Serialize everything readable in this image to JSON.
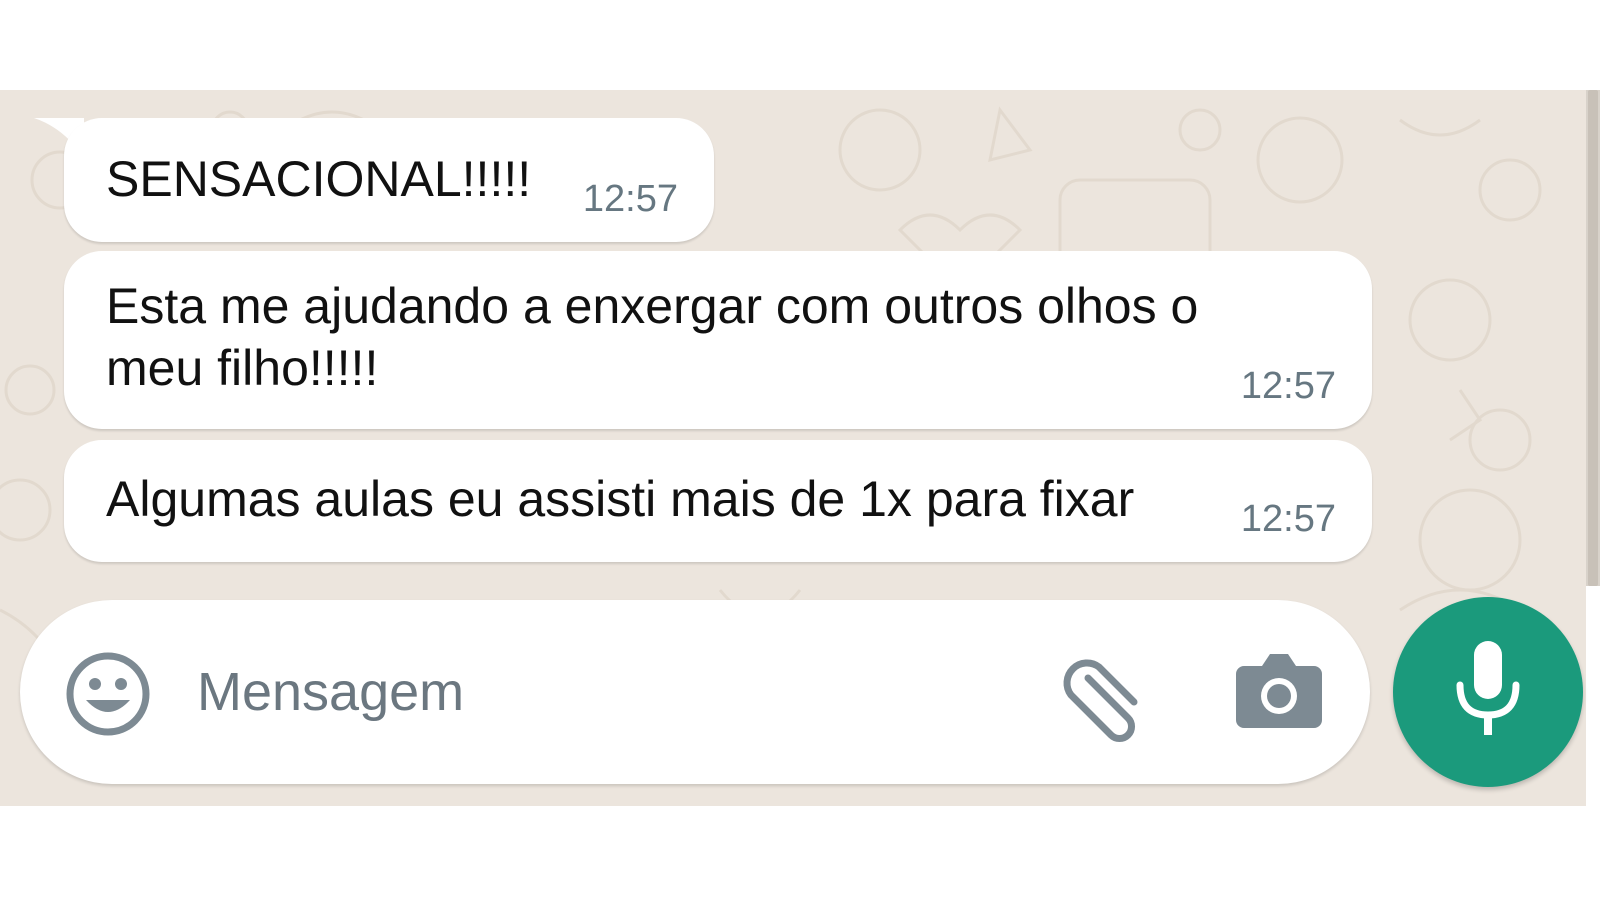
{
  "messages": [
    {
      "text": "SENSACIONAL!!!!!",
      "time": "12:57"
    },
    {
      "text": "Esta me ajudando a enxergar com outros olhos o\nmeu filho!!!!!",
      "time": "12:57"
    },
    {
      "text": "Algumas aulas eu assisti mais de 1x para fixar",
      "time": "12:57"
    }
  ],
  "composer": {
    "placeholder": "Mensagem",
    "emoji_icon": "smiley-icon",
    "attach_icon": "paperclip-icon",
    "camera_icon": "camera-icon",
    "mic_icon": "microphone-icon"
  },
  "colors": {
    "chat_background": "#ece5dd",
    "bubble": "#ffffff",
    "timestamp": "#667781",
    "accent": "#1b9a7c",
    "icon_gray": "#7d8a93"
  }
}
